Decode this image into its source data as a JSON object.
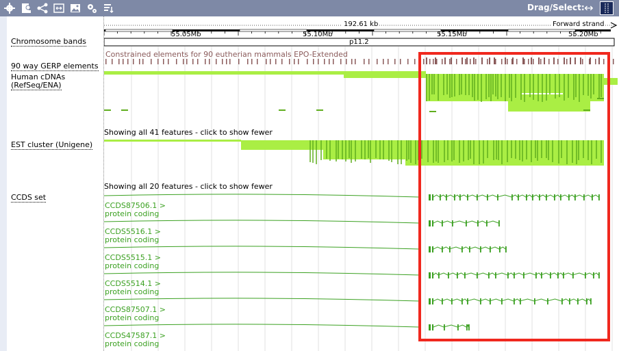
{
  "toolbar": {
    "icons": [
      "gear-icon",
      "person-icon",
      "share-icon",
      "resize-icon",
      "image-icon",
      "config-icon",
      "sort-icon"
    ],
    "drag_select_label": "Drag/Select:",
    "drag_mode_icon": "left-right-arrow-icon",
    "select_mode_icon": "select-mode-icon"
  },
  "ruler": {
    "span_label": "192.61 kb",
    "strand_label": "Forward strand",
    "ticks": [
      "55.05Mb",
      "55.10Mb",
      "55.15Mb",
      "55.20Mb"
    ],
    "band_label": "p11.2"
  },
  "tracks": {
    "chromosome_bands": "Chromosome bands",
    "gerp": "90 way GERP elements",
    "gerp_caption": "Constrained elements for 90 eutherian mammals EPO-Extended",
    "human_cdnas_line1": "Human cDNAs",
    "human_cdnas_line2": "(RefSeq/ENA)",
    "est_notice": "Showing all 41 features - click to show fewer",
    "est_cluster": "EST cluster (Unigene)",
    "ccds_notice": "Showing all 20 features - click to show fewer",
    "ccds_set": "CCDS set"
  },
  "ccds_features": [
    {
      "id": "CCDS87506.1 >",
      "type": "protein coding"
    },
    {
      "id": "CCDS5516.1 >",
      "type": "protein coding"
    },
    {
      "id": "CCDS5515.1 >",
      "type": "protein coding"
    },
    {
      "id": "CCDS5514.1 >",
      "type": "protein coding"
    },
    {
      "id": "CCDS87507.1 >",
      "type": "protein coding"
    },
    {
      "id": "CCDS47587.1 >",
      "type": "protein coding"
    }
  ],
  "colors": {
    "toolbar_bg": "#7e89a6",
    "feature_green": "#aaee44",
    "feature_dark_green": "#5fae1e",
    "gerp_mark": "#8a5a5a",
    "ccds_green": "#3aa020",
    "highlight_red": "#f0281e"
  }
}
